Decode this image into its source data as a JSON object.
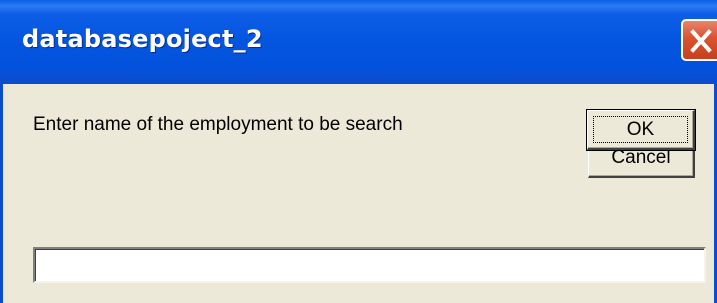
{
  "window": {
    "title": "databasepoject_2",
    "close_icon": "close-x"
  },
  "dialog": {
    "prompt": "Enter name of the employment to be search",
    "ok_label": "OK",
    "cancel_label": "Cancel",
    "input_value": ""
  },
  "colors": {
    "titlebar": "#0455e0",
    "close_button": "#d9532e",
    "dialog_background": "#ece9d8"
  }
}
